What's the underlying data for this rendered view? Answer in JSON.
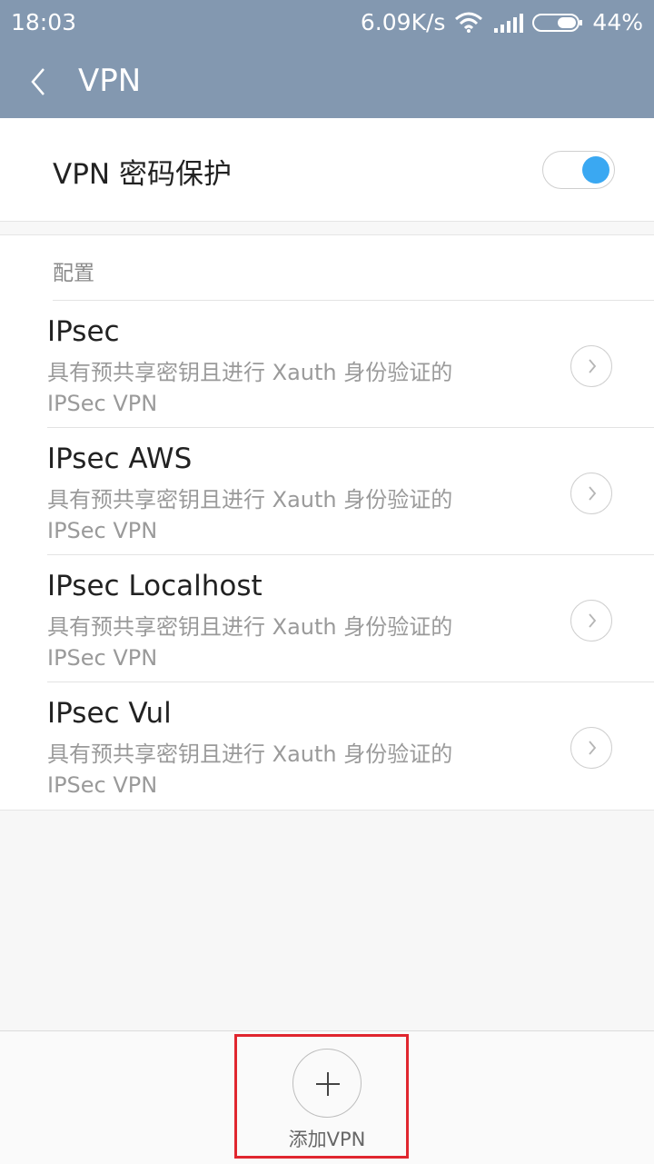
{
  "status_bar": {
    "time": "18:03",
    "net_speed": "6.09K/s",
    "battery": "44%"
  },
  "title_bar": {
    "title": "VPN"
  },
  "password_protection": {
    "label": "VPN 密码保护",
    "toggle_on": true,
    "accent_color": "#3aa8f2"
  },
  "config": {
    "header": "配置",
    "items": [
      {
        "name": "IPsec",
        "desc_line1": "具有预共享密钥且进行 Xauth 身份验证的",
        "desc_line2": "IPSec VPN"
      },
      {
        "name": "IPsec AWS",
        "desc_line1": "具有预共享密钥且进行 Xauth 身份验证的",
        "desc_line2": "IPSec VPN"
      },
      {
        "name": "IPsec Localhost",
        "desc_line1": "具有预共享密钥且进行 Xauth 身份验证的",
        "desc_line2": "IPSec VPN"
      },
      {
        "name": "IPsec Vul",
        "desc_line1": "具有预共享密钥且进行 Xauth 身份验证的",
        "desc_line2": "IPSec VPN"
      }
    ]
  },
  "bottom": {
    "add_label": "添加VPN"
  }
}
